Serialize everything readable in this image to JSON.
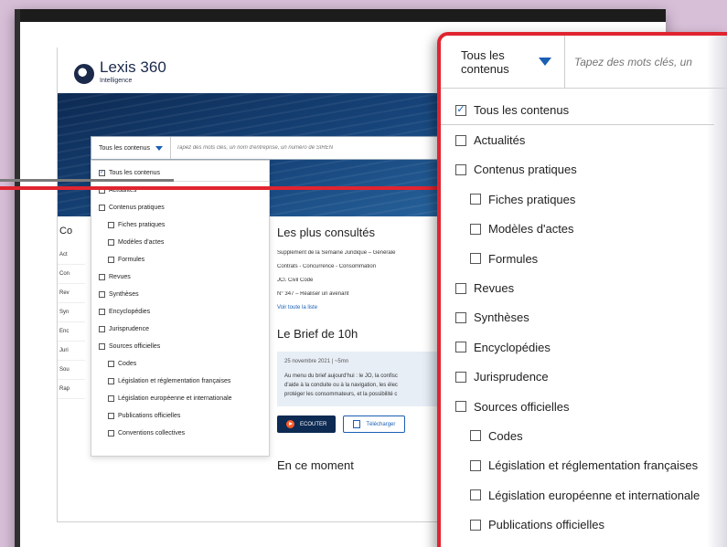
{
  "app": {
    "logo_name": "Lexis 360",
    "logo_sub": "Intelligence"
  },
  "search": {
    "scope_label": "Tous les contenus",
    "placeholder_small": "Tapez des mots clés, un nom d'entreprise, un numéro de SIREN",
    "placeholder_zoom": "Tapez des mots clés, un"
  },
  "dropdown": {
    "items": [
      {
        "label": "Tous les contenus",
        "checked": true,
        "indent": false,
        "separator": true
      },
      {
        "label": "Actualités",
        "checked": false,
        "indent": false,
        "separator": false
      },
      {
        "label": "Contenus pratiques",
        "checked": false,
        "indent": false,
        "separator": false
      },
      {
        "label": "Fiches pratiques",
        "checked": false,
        "indent": true,
        "separator": false
      },
      {
        "label": "Modèles d'actes",
        "checked": false,
        "indent": true,
        "separator": false
      },
      {
        "label": "Formules",
        "checked": false,
        "indent": true,
        "separator": false
      },
      {
        "label": "Revues",
        "checked": false,
        "indent": false,
        "separator": false
      },
      {
        "label": "Synthèses",
        "checked": false,
        "indent": false,
        "separator": false
      },
      {
        "label": "Encyclopédies",
        "checked": false,
        "indent": false,
        "separator": false
      },
      {
        "label": "Jurisprudence",
        "checked": false,
        "indent": false,
        "separator": false
      },
      {
        "label": "Sources officielles",
        "checked": false,
        "indent": false,
        "separator": false
      },
      {
        "label": "Codes",
        "checked": false,
        "indent": true,
        "separator": false
      },
      {
        "label": "Législation et réglementation françaises",
        "checked": false,
        "indent": true,
        "separator": false
      },
      {
        "label": "Législation européenne et internationale",
        "checked": false,
        "indent": true,
        "separator": false
      },
      {
        "label": "Publications officielles",
        "checked": false,
        "indent": true,
        "separator": false
      },
      {
        "label": "Conventions collectives",
        "checked": false,
        "indent": true,
        "separator": false
      }
    ]
  },
  "left_nav": {
    "title": "Co",
    "items": [
      "Act",
      "Con",
      "Rev",
      "Syn",
      "Enc",
      "Juri",
      "Sou",
      "Rap"
    ]
  },
  "most_viewed": {
    "title": "Les plus consultés",
    "items": [
      "Supplément de la Semaine Juridique – Générale",
      "Contrats - Concurrence - Consommation",
      "JCl. Civil Code",
      "N° 347 – Réaliser un avenant"
    ],
    "see_all": "Voir toute la liste"
  },
  "brief": {
    "title": "Le Brief de 10h",
    "date": "25 novembre 2021 | ~5mn",
    "lines": [
      "Au menu du brief aujourd'hui : le JO, la confisc",
      "d'aide à la conduite ou à la navigation, les élec",
      "protéger les consommateurs, et la possibilité c"
    ],
    "listen_label": "ECOUTER",
    "download_label": "Télécharger"
  },
  "next_section": {
    "title": "En ce moment"
  },
  "colors": {
    "highlight": "#e0242f",
    "navy": "#0d2a52",
    "accent": "#1a5fb4",
    "play": "#ff5a2a"
  }
}
